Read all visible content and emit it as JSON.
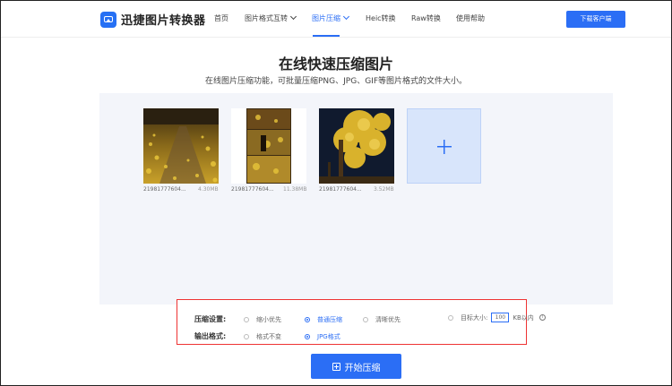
{
  "app": {
    "name": "迅捷图片转换器"
  },
  "nav": {
    "items": [
      {
        "label": "首页"
      },
      {
        "label": "图片格式互转"
      },
      {
        "label": "图片压缩"
      },
      {
        "label": "Heic转换"
      },
      {
        "label": "Raw转换"
      },
      {
        "label": "使用帮助"
      }
    ],
    "download_label": "下载客户端"
  },
  "main": {
    "title": "在线快速压缩图片",
    "subtitle": "在线图片压缩功能，可批量压缩PNG、JPG、GIF等图片格式的文件大小。"
  },
  "files": [
    {
      "name": "21981777604...",
      "size": "4.30MB"
    },
    {
      "name": "21981777604...",
      "size": "11.38MB"
    },
    {
      "name": "21981777604...",
      "size": "3.52MB"
    }
  ],
  "settings": {
    "compress_label": "压缩设置:",
    "compress_options": [
      {
        "label": "缩小优先"
      },
      {
        "label": "普通压缩"
      },
      {
        "label": "清晰优先"
      },
      {
        "label": "目标大小:"
      }
    ],
    "target_size_value": "100",
    "target_size_unit": "KB以内",
    "info_glyph": "i",
    "format_label": "输出格式:",
    "format_options": [
      {
        "label": "格式不变"
      },
      {
        "label": "JPG格式"
      }
    ]
  },
  "start_button": {
    "label": "开始压缩"
  },
  "colors": {
    "accent": "#2b6ef5",
    "highlight_border": "#e33333",
    "upload_bg": "#f3f5fa"
  }
}
